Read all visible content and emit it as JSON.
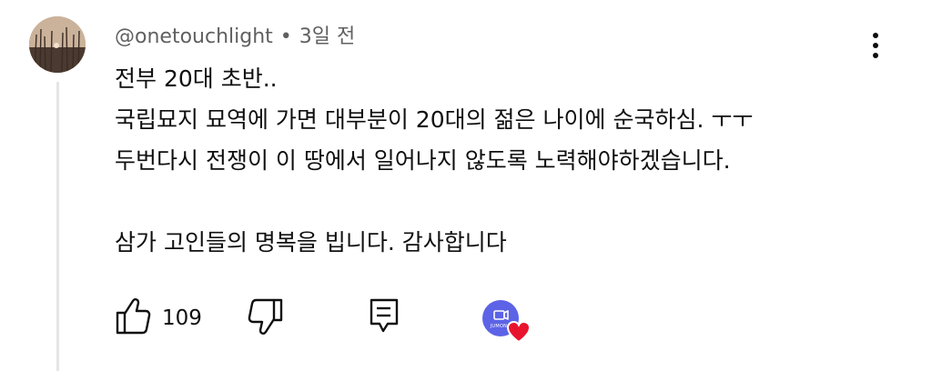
{
  "comment": {
    "author": "@onetouchlight",
    "separator": "•",
    "time": "3일 전",
    "lines": [
      "전부 20대 초반..",
      "국립묘지 묘역에 가면 대부분이 20대의 젊은 나이에 순국하심. ㅜㅜ",
      "두번다시 전쟁이 이 땅에서 일어나지 않도록 노력해야하겠습니다.",
      "",
      "삼가 고인들의 명복을 빕니다. 감사합니다"
    ],
    "like_count": "109"
  },
  "creator_badge_text": "JUMONG",
  "icons": {
    "menu": "more-vert-icon",
    "like": "thumb-up-icon",
    "dislike": "thumb-down-icon",
    "reply": "reply-comment-icon",
    "heart": "heart-icon"
  },
  "colors": {
    "heart": "#e8142e",
    "creator_avatar": "#5c63e6",
    "meta_text": "#606060"
  }
}
